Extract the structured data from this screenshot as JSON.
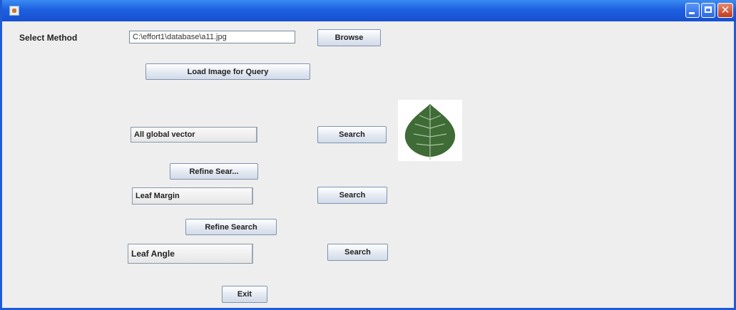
{
  "window": {
    "title": ""
  },
  "form": {
    "select_method_label": "Select Method",
    "path_value": "C:\\effort1\\database\\a11.jpg",
    "browse_label": "Browse",
    "load_label": "Load Image for Query",
    "refine_1_label": "Refine Sear...",
    "refine_2_label": "Refine Search",
    "exit_label": "Exit"
  },
  "rows": [
    {
      "field": "All global vector",
      "search_label": "Search"
    },
    {
      "field": "Leaf Margin",
      "search_label": "Search"
    },
    {
      "field": "Leaf Angle",
      "search_label": "Search"
    }
  ],
  "preview": {
    "icon": "leaf-image",
    "leaf_color": "#3f6b36",
    "vein_color": "#a9c4a0"
  }
}
